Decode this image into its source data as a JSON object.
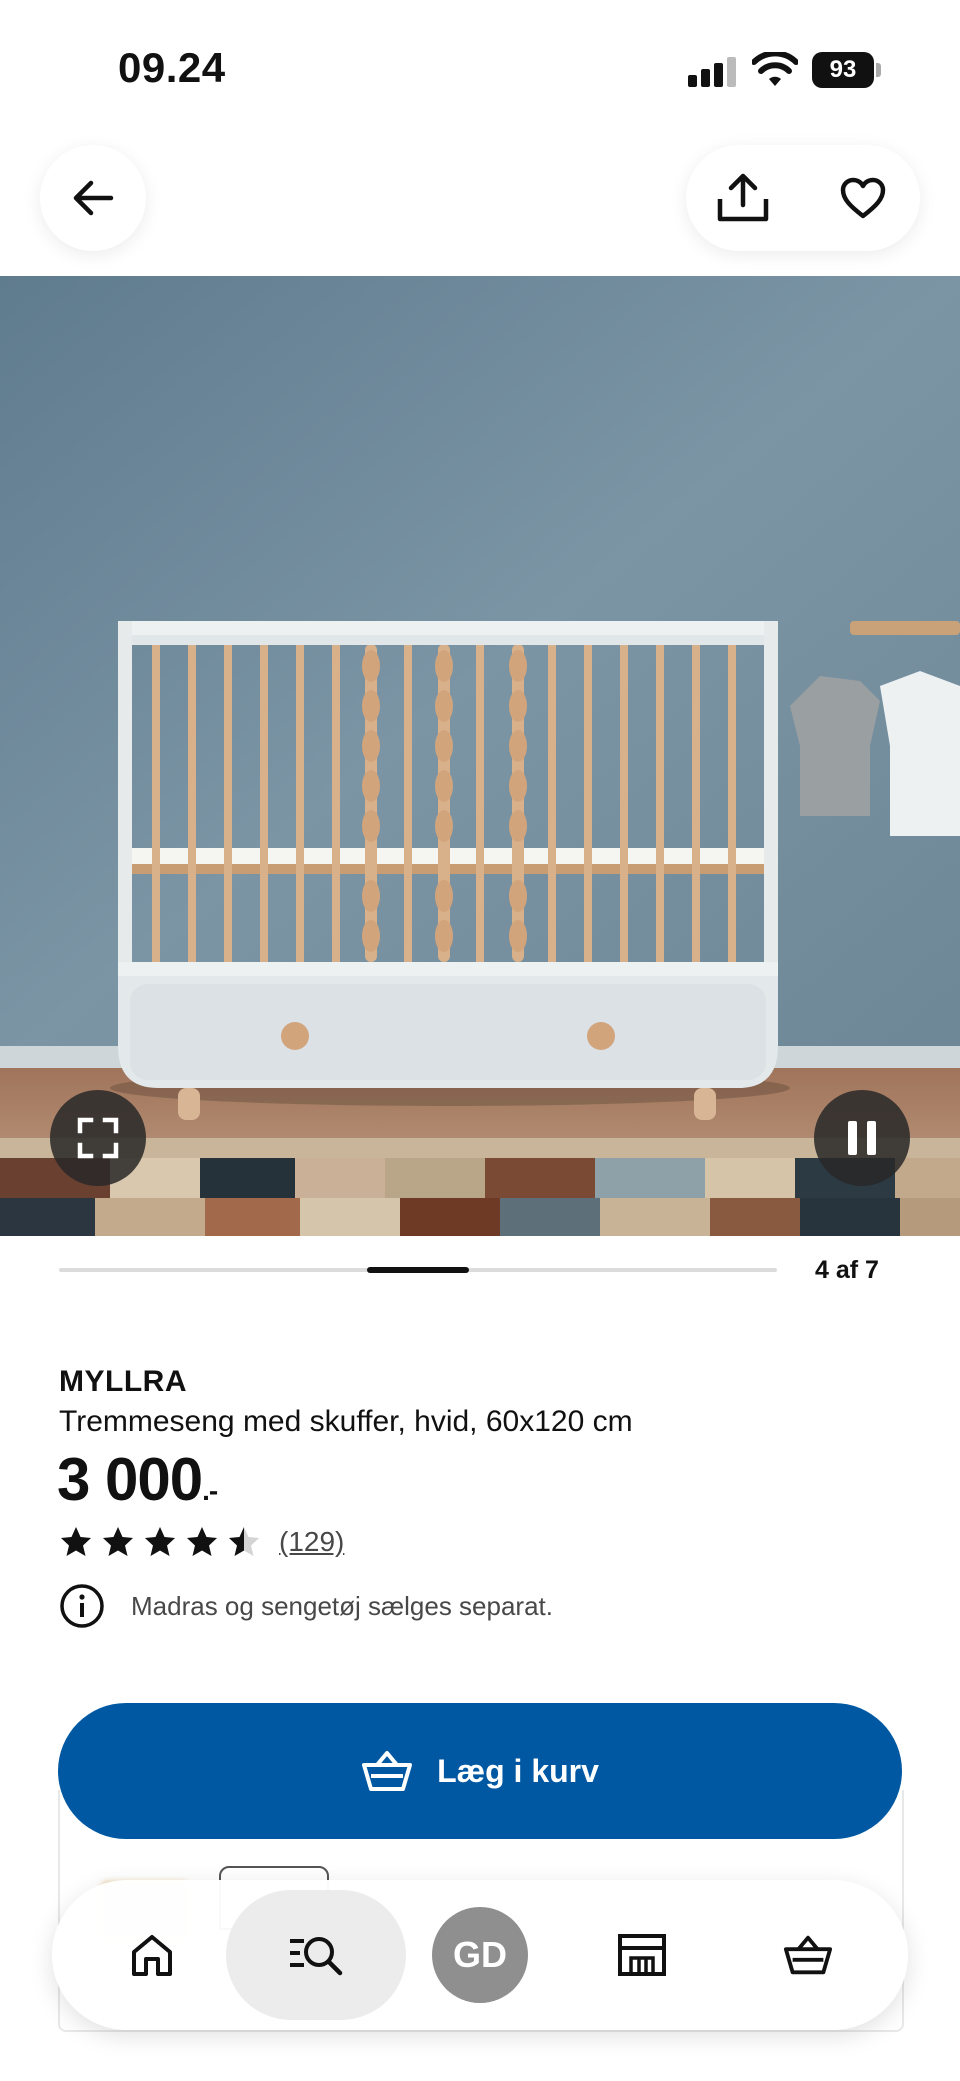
{
  "status_bar": {
    "time": "09.24",
    "battery": "93"
  },
  "top_nav": {
    "back_icon": "arrow-left-icon",
    "share_icon": "share-icon",
    "favorite_icon": "heart-icon"
  },
  "gallery": {
    "counter": "4 af 7",
    "current_index": 4,
    "total": 7,
    "fullscreen_icon": "expand-icon",
    "pause_icon": "pause-icon"
  },
  "product": {
    "brand": "MYLLRA",
    "description": "Tremmeseng med skuffer, hvid, 60x120 cm",
    "price": "3 000",
    "price_suffix": ".-",
    "rating_value": 4.5,
    "review_count": "(129)",
    "notice": "Madras og sengetøj sælges separat."
  },
  "cart_button": {
    "label": "Læg i kurv",
    "icon": "basket-icon",
    "color": "#0058a3"
  },
  "bottom_nav": {
    "items": [
      {
        "name": "home",
        "icon": "home-icon"
      },
      {
        "name": "search",
        "icon": "search-list-icon",
        "active": true
      },
      {
        "name": "profile",
        "label": "GD"
      },
      {
        "name": "store",
        "icon": "store-icon"
      },
      {
        "name": "basket",
        "icon": "basket-icon"
      }
    ]
  }
}
